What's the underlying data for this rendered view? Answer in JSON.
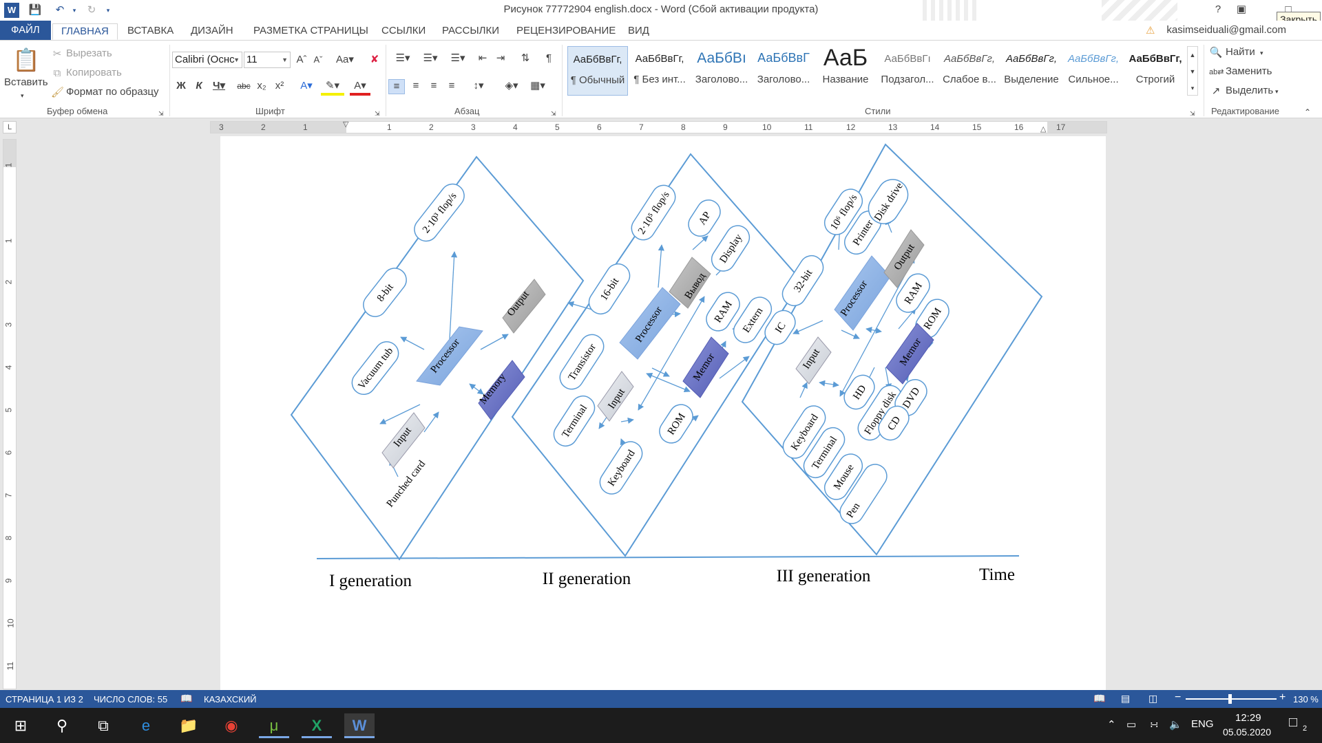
{
  "window": {
    "title": "Рисунок 77772904 english.docx - Word (Сбой активации продукта)",
    "help": "?",
    "close_tooltip": "Закрыть"
  },
  "tabs": [
    "ФАЙЛ",
    "ГЛАВНАЯ",
    "ВСТАВКА",
    "ДИЗАЙН",
    "РАЗМЕТКА СТРАНИЦЫ",
    "ССЫЛКИ",
    "РАССЫЛКИ",
    "РЕЦЕНЗИРОВАНИЕ",
    "ВИД"
  ],
  "active_tab": "ГЛАВНАЯ",
  "account": "kasimseiduali@gmail.com",
  "ribbon": {
    "clipboard": {
      "paste": "Вставить",
      "cut": "Вырезать",
      "copy": "Копировать",
      "format_painter": "Формат по образцу",
      "label": "Буфер обмена"
    },
    "font": {
      "font_name": "Calibri (Оснс",
      "font_size": "11",
      "label": "Шрифт"
    },
    "paragraph": {
      "label": "Абзац"
    },
    "styles": {
      "label": "Стили",
      "items": [
        {
          "preview": "АаБбВвГг,",
          "name": "¶ Обычный"
        },
        {
          "preview": "АаБбВвГг,",
          "name": "¶ Без инт..."
        },
        {
          "preview": "АаБбВı",
          "name": "Заголово..."
        },
        {
          "preview": "АаБбВвГ",
          "name": "Заголово..."
        },
        {
          "preview": "АаБ",
          "name": "Название"
        },
        {
          "preview": "АаБбВвГı",
          "name": "Подзагол..."
        },
        {
          "preview": "АаБбВвГг,",
          "name": "Слабое в..."
        },
        {
          "preview": "АаБбВвГг,",
          "name": "Выделение"
        },
        {
          "preview": "АаБбВвГг,",
          "name": "Сильное..."
        },
        {
          "preview": "АаБбВвГг,",
          "name": "Строгий"
        }
      ]
    },
    "editing": {
      "find": "Найти",
      "replace": "Заменить",
      "select": "Выделить",
      "label": "Редактирование"
    }
  },
  "ruler": {
    "h_left": [
      "3",
      "2",
      "1"
    ],
    "h_right": [
      "1",
      "2",
      "3",
      "4",
      "5",
      "6",
      "7",
      "8",
      "9",
      "10",
      "11",
      "12",
      "13",
      "14",
      "15",
      "16",
      "17"
    ],
    "v": [
      "1",
      "1",
      "2",
      "3",
      "4",
      "5",
      "6",
      "7",
      "8",
      "9",
      "10",
      "11"
    ],
    "corner": "L"
  },
  "diagram": {
    "gen1": {
      "center": "Processor",
      "nodes": {
        "input": "Input",
        "output": "Output",
        "memory": "Memory"
      },
      "pills": [
        "Vacuum tub",
        "8-bit",
        "2·10³ flop/s"
      ],
      "free_label": "Punched card",
      "caption": "I generation"
    },
    "gen2": {
      "center": "Processor",
      "nodes": {
        "input": "Input",
        "output": "Вывод",
        "memory": "Memor"
      },
      "pills": [
        "Transistor",
        "16-bit",
        "2·10⁵ flop/s",
        "AP",
        "Display",
        "RAM",
        "Extern",
        "ROM",
        "Terminal",
        "Keyboard"
      ],
      "caption": "II generation"
    },
    "gen3": {
      "center": "Processor",
      "nodes": {
        "input": "Input",
        "output": "Output",
        "memory": "Memor"
      },
      "pills": [
        "IC",
        "32-bit",
        "10⁶ flop/s",
        "Printer",
        "Disk drive",
        "RAM",
        "ROM",
        "HD",
        "Floppy disk",
        "DVD",
        "CD",
        "Keyboard",
        "Terminal",
        "Mouse",
        "Pen"
      ],
      "caption": "III generation"
    },
    "time_label": "Time"
  },
  "status": {
    "page": "СТРАНИЦА 1 ИЗ 2",
    "words": "ЧИСЛО СЛОВ: 55",
    "language": "КАЗАХСКИЙ",
    "zoom": "130 %"
  },
  "taskbar": {
    "lang": "ENG",
    "time": "12:29",
    "date": "05.05.2020",
    "notifications": "2"
  },
  "colors": {
    "brand": "#2b579a",
    "diagram_line": "#5b9bd5",
    "processor": "#8fb4e3",
    "memory": "#6670c4",
    "input": "#d5d9df",
    "output": "#a8a8a8"
  }
}
